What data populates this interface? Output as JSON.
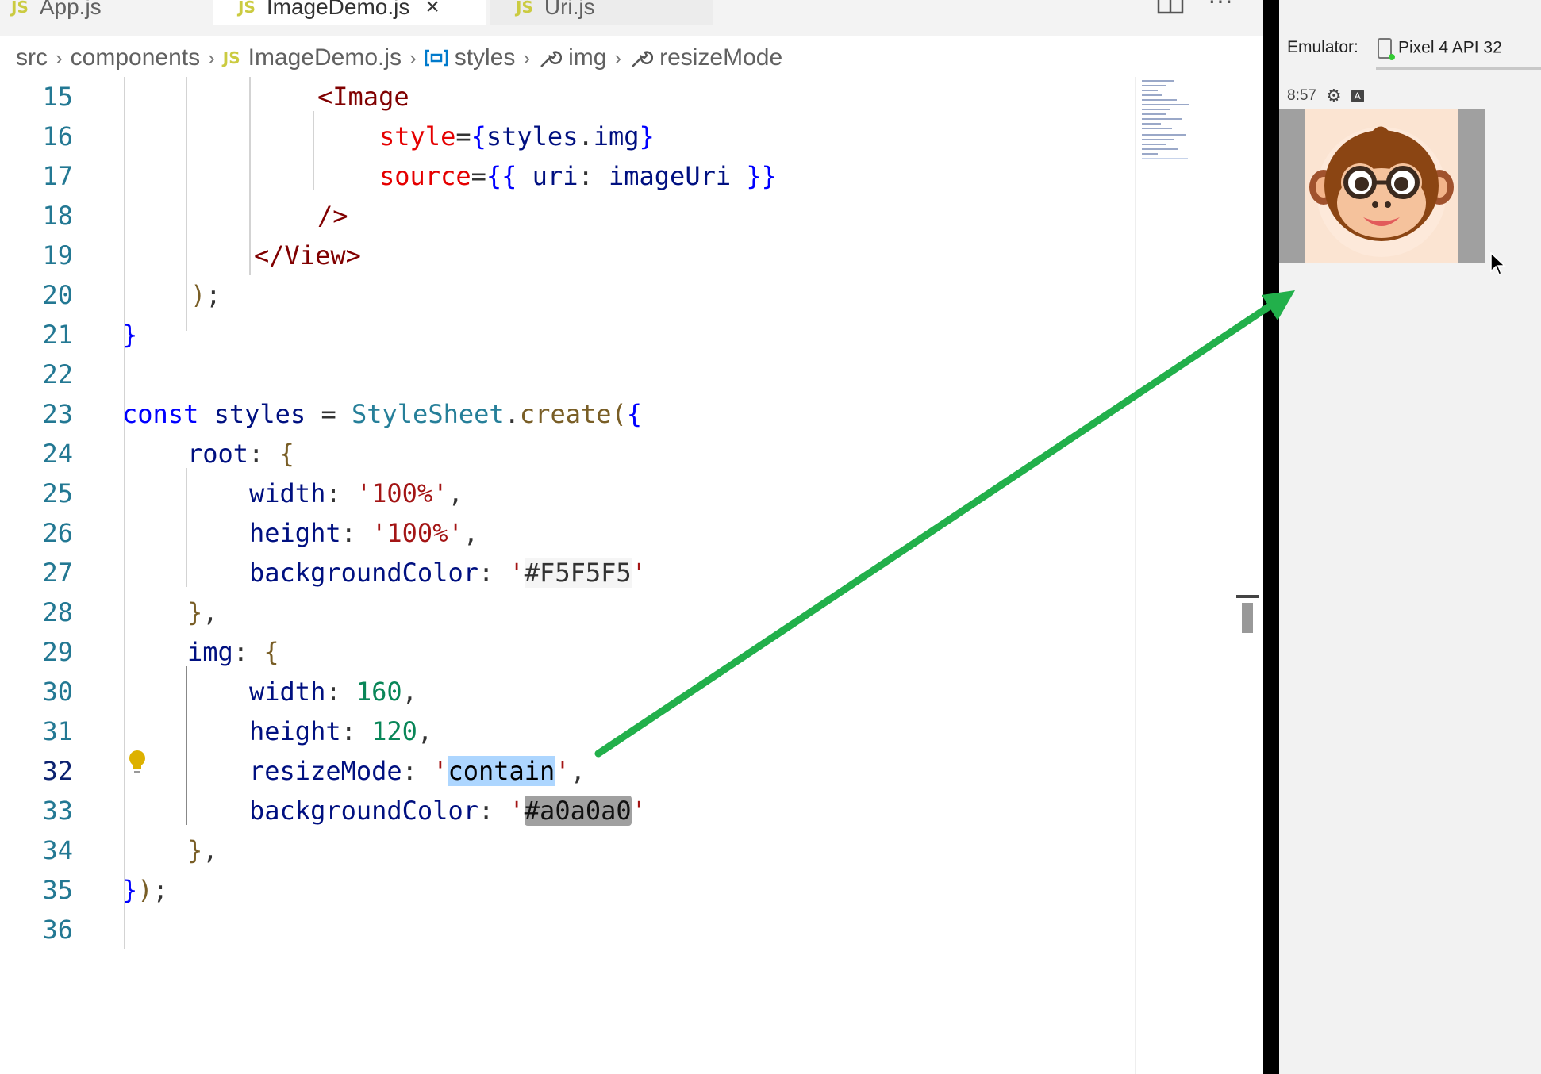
{
  "tabs": [
    {
      "icon": "JS",
      "label": "App.js",
      "active": false
    },
    {
      "icon": "JS",
      "label": "ImageDemo.js",
      "active": true,
      "close": "×"
    },
    {
      "icon": "JS",
      "label": "Uri.js",
      "active": false
    }
  ],
  "tab_actions": {
    "more": "···"
  },
  "breadcrumb": {
    "items": [
      "src",
      "components",
      "ImageDemo.js",
      "styles",
      "img",
      "resizeMode"
    ],
    "js_badge": "JS",
    "separator": "›"
  },
  "code": {
    "current_line": 32,
    "lines": [
      {
        "num": "15",
        "tokens": [
          [
            "t",
            "<Image"
          ]
        ]
      },
      {
        "num": "16",
        "tokens": [
          [
            "a",
            "style"
          ],
          [
            "p",
            "="
          ],
          [
            "k",
            "{"
          ],
          [
            "v",
            "styles"
          ],
          [
            "p",
            "."
          ],
          [
            "v",
            "img"
          ],
          [
            "k",
            "}"
          ]
        ]
      },
      {
        "num": "17",
        "tokens": [
          [
            "a",
            "source"
          ],
          [
            "p",
            "="
          ],
          [
            "k",
            "{{"
          ],
          [
            "p",
            " "
          ],
          [
            "v",
            "uri"
          ],
          [
            "p",
            ": "
          ],
          [
            "v",
            "imageUri"
          ],
          [
            "p",
            " "
          ],
          [
            "k",
            "}}"
          ]
        ]
      },
      {
        "num": "18",
        "tokens": [
          [
            "t",
            "/>"
          ]
        ]
      },
      {
        "num": "19",
        "tokens": [
          [
            "t",
            "</View>"
          ]
        ]
      },
      {
        "num": "20",
        "tokens": [
          [
            "f",
            ")"
          ],
          [
            "p",
            ";"
          ]
        ]
      },
      {
        "num": "21",
        "tokens": [
          [
            "k",
            "}"
          ]
        ]
      },
      {
        "num": "22",
        "tokens": []
      },
      {
        "num": "23",
        "tokens": [
          [
            "k",
            "const"
          ],
          [
            "p",
            " "
          ],
          [
            "v",
            "styles"
          ],
          [
            "p",
            " = "
          ],
          [
            "c",
            "StyleSheet"
          ],
          [
            "p",
            "."
          ],
          [
            "f",
            "create"
          ],
          [
            "f",
            "("
          ],
          [
            "k",
            "{"
          ]
        ]
      },
      {
        "num": "24",
        "tokens": [
          [
            "v",
            "root"
          ],
          [
            "p",
            ": "
          ],
          [
            "f",
            "{"
          ]
        ]
      },
      {
        "num": "25",
        "tokens": [
          [
            "v",
            "width"
          ],
          [
            "p",
            ": "
          ],
          [
            "s",
            "'100%'"
          ],
          [
            "p",
            ","
          ]
        ]
      },
      {
        "num": "26",
        "tokens": [
          [
            "v",
            "height"
          ],
          [
            "p",
            ": "
          ],
          [
            "s",
            "'100%'"
          ],
          [
            "p",
            ","
          ]
        ]
      },
      {
        "num": "27",
        "tokens": [
          [
            "v",
            "backgroundColor"
          ],
          [
            "p",
            ": "
          ],
          [
            "s",
            "'"
          ],
          [
            "sw1",
            "#F5F5F5"
          ],
          [
            "s",
            "'"
          ]
        ]
      },
      {
        "num": "28",
        "tokens": [
          [
            "f",
            "}"
          ],
          [
            "p",
            ","
          ]
        ]
      },
      {
        "num": "29",
        "tokens": [
          [
            "v",
            "img"
          ],
          [
            "p",
            ": "
          ],
          [
            "f",
            "{"
          ]
        ]
      },
      {
        "num": "30",
        "tokens": [
          [
            "v",
            "width"
          ],
          [
            "p",
            ": "
          ],
          [
            "n",
            "160"
          ],
          [
            "p",
            ","
          ]
        ]
      },
      {
        "num": "31",
        "tokens": [
          [
            "v",
            "height"
          ],
          [
            "p",
            ": "
          ],
          [
            "n",
            "120"
          ],
          [
            "p",
            ","
          ]
        ]
      },
      {
        "num": "32",
        "tokens": [
          [
            "v",
            "resizeMode"
          ],
          [
            "p",
            ": "
          ],
          [
            "s",
            "'"
          ],
          [
            "sel",
            "contain"
          ],
          [
            "s",
            "'"
          ],
          [
            "p",
            ","
          ]
        ]
      },
      {
        "num": "33",
        "tokens": [
          [
            "v",
            "backgroundColor"
          ],
          [
            "p",
            ": "
          ],
          [
            "s",
            "'"
          ],
          [
            "sw2",
            "#a0a0a0"
          ],
          [
            "s",
            "'"
          ]
        ]
      },
      {
        "num": "34",
        "tokens": [
          [
            "f",
            "}"
          ],
          [
            "p",
            ","
          ]
        ]
      },
      {
        "num": "35",
        "tokens": [
          [
            "k",
            "}"
          ],
          [
            "f",
            ")"
          ],
          [
            "p",
            ";"
          ]
        ]
      },
      {
        "num": "36",
        "tokens": []
      }
    ]
  },
  "emulator": {
    "label": "Emulator:",
    "device": "Pixel 4 API 32",
    "time": "8:57",
    "image_bg": "#a0a0a0"
  },
  "colors": {
    "arrow": "#22b04b",
    "accent": "#007acc"
  }
}
